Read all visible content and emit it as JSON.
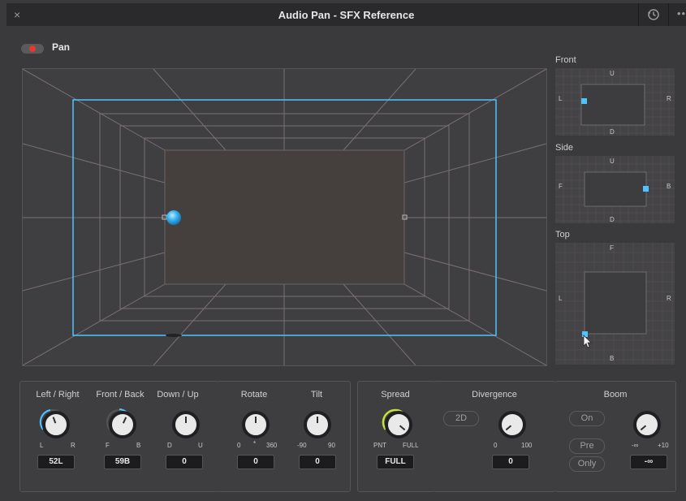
{
  "window": {
    "title": "Audio Pan - SFX Reference",
    "close_glyph": "×",
    "more_glyph": "•••",
    "history_icon": "history-icon"
  },
  "pan": {
    "label": "Pan",
    "enabled": true
  },
  "mini_views": {
    "front": {
      "label": "Front",
      "top": "U",
      "bottom": "D",
      "left": "L",
      "right": "R"
    },
    "side": {
      "label": "Side",
      "top": "U",
      "bottom": "D",
      "left": "F",
      "right": "B"
    },
    "top": {
      "label": "Top",
      "top": "F",
      "bottom": "B",
      "left": "L",
      "right": "R"
    }
  },
  "controls": {
    "left_right": {
      "label": "Left / Right",
      "min": "L",
      "max": "R",
      "value": "52L"
    },
    "front_back": {
      "label": "Front / Back",
      "min": "F",
      "max": "B",
      "value": "59B"
    },
    "down_up": {
      "label": "Down / Up",
      "min": "D",
      "max": "U",
      "value": "0"
    },
    "rotate": {
      "label": "Rotate",
      "min": "0",
      "mid": "*",
      "max": "360",
      "value": "0"
    },
    "tilt": {
      "label": "Tilt",
      "min": "-90",
      "max": "90",
      "value": "0"
    },
    "spread": {
      "label": "Spread",
      "min": "PNT",
      "max": "FULL",
      "value": "FULL"
    },
    "divergence": {
      "label": "Divergence",
      "mode": "2D",
      "min": "0",
      "max": "100",
      "value": "0"
    },
    "boom": {
      "label": "Boom",
      "on": "On",
      "pre": "Pre",
      "only": "Only",
      "min": "-∞",
      "max": "+10",
      "value": "-∞"
    }
  },
  "colors": {
    "accent_blue": "#4fc3ff",
    "pan_red": "#e23a2f",
    "spread_green": "#c6e23a"
  }
}
